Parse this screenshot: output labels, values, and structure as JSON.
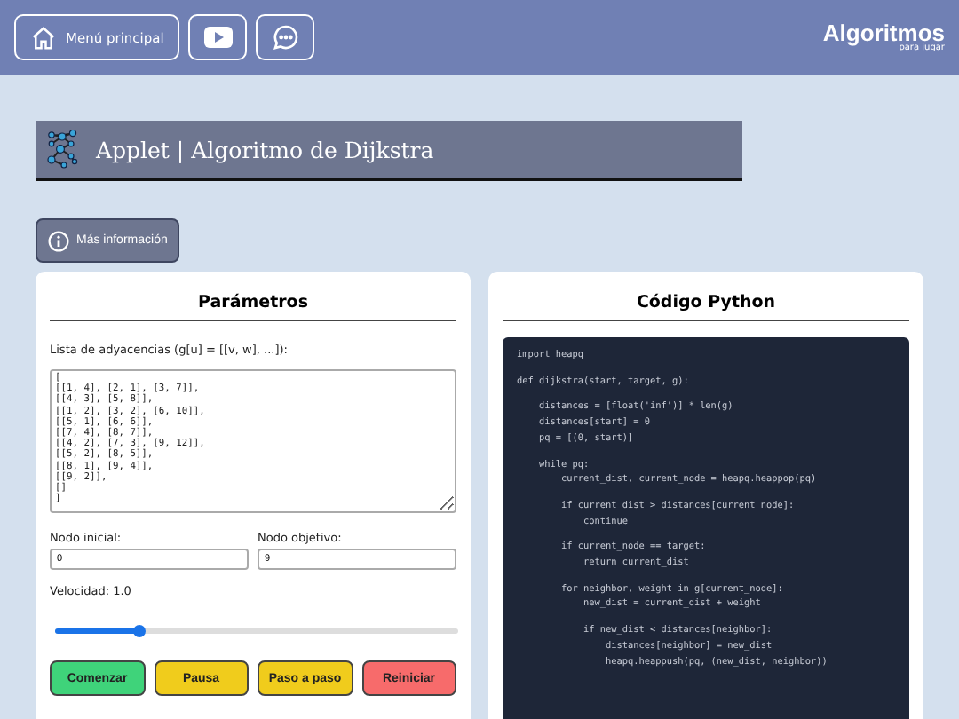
{
  "header": {
    "menu_button": "Menú principal",
    "logo_text": "Algoritmos",
    "logo_subtext": "para jugar"
  },
  "title_bar": {
    "title": "Applet | Algoritmo de Dijkstra"
  },
  "info_button": "Más información",
  "parameters": {
    "heading": "Parámetros",
    "adjacency_label": "Lista de adyacencias (g[u] = [[v, w], ...]):",
    "adjacency_value": "[\n[[1, 4], [2, 1], [3, 7]],\n[[4, 3], [5, 8]],\n[[1, 2], [3, 2], [6, 10]],\n[[5, 1], [6, 6]],\n[[7, 4], [8, 7]],\n[[4, 2], [7, 3], [9, 12]],\n[[5, 2], [8, 5]],\n[[8, 1], [9, 4]],\n[[9, 2]],\n[]\n]",
    "fields": [
      {
        "label": "Nodo inicial:",
        "value": "0"
      },
      {
        "label": "Nodo objetivo:",
        "value": "9"
      }
    ],
    "speed_label": "Velocidad: 1.0",
    "speed": {
      "level": 0.21
    },
    "buttons": [
      {
        "label": "Comenzar",
        "kind": "start"
      },
      {
        "label": "Pausa",
        "kind": "pause"
      },
      {
        "label": "Paso a paso",
        "kind": "step"
      },
      {
        "label": "Reiniciar",
        "kind": "reset"
      }
    ]
  },
  "code": {
    "heading": "Código Python",
    "blocks": [
      [
        "import heapq"
      ],
      [
        "def dijkstra(start, target, g):"
      ],
      [
        "    distances = [float('inf')] * len(g)",
        "    distances[start] = 0",
        "    pq = [(0, start)]"
      ],
      [
        "    while pq:",
        "        current_dist, current_node = heapq.heappop(pq)"
      ],
      [
        "        if current_dist > distances[current_node]:",
        "            continue"
      ],
      [
        "        if current_node == target:",
        "            return current_dist"
      ],
      [
        "        for neighbor, weight in g[current_node]:",
        "            new_dist = current_dist + weight"
      ],
      [
        "            if new_dist < distances[neighbor]:",
        "                distances[neighbor] = new_dist",
        "                heapq.heappush(pq, (new_dist, neighbor))"
      ]
    ]
  }
}
